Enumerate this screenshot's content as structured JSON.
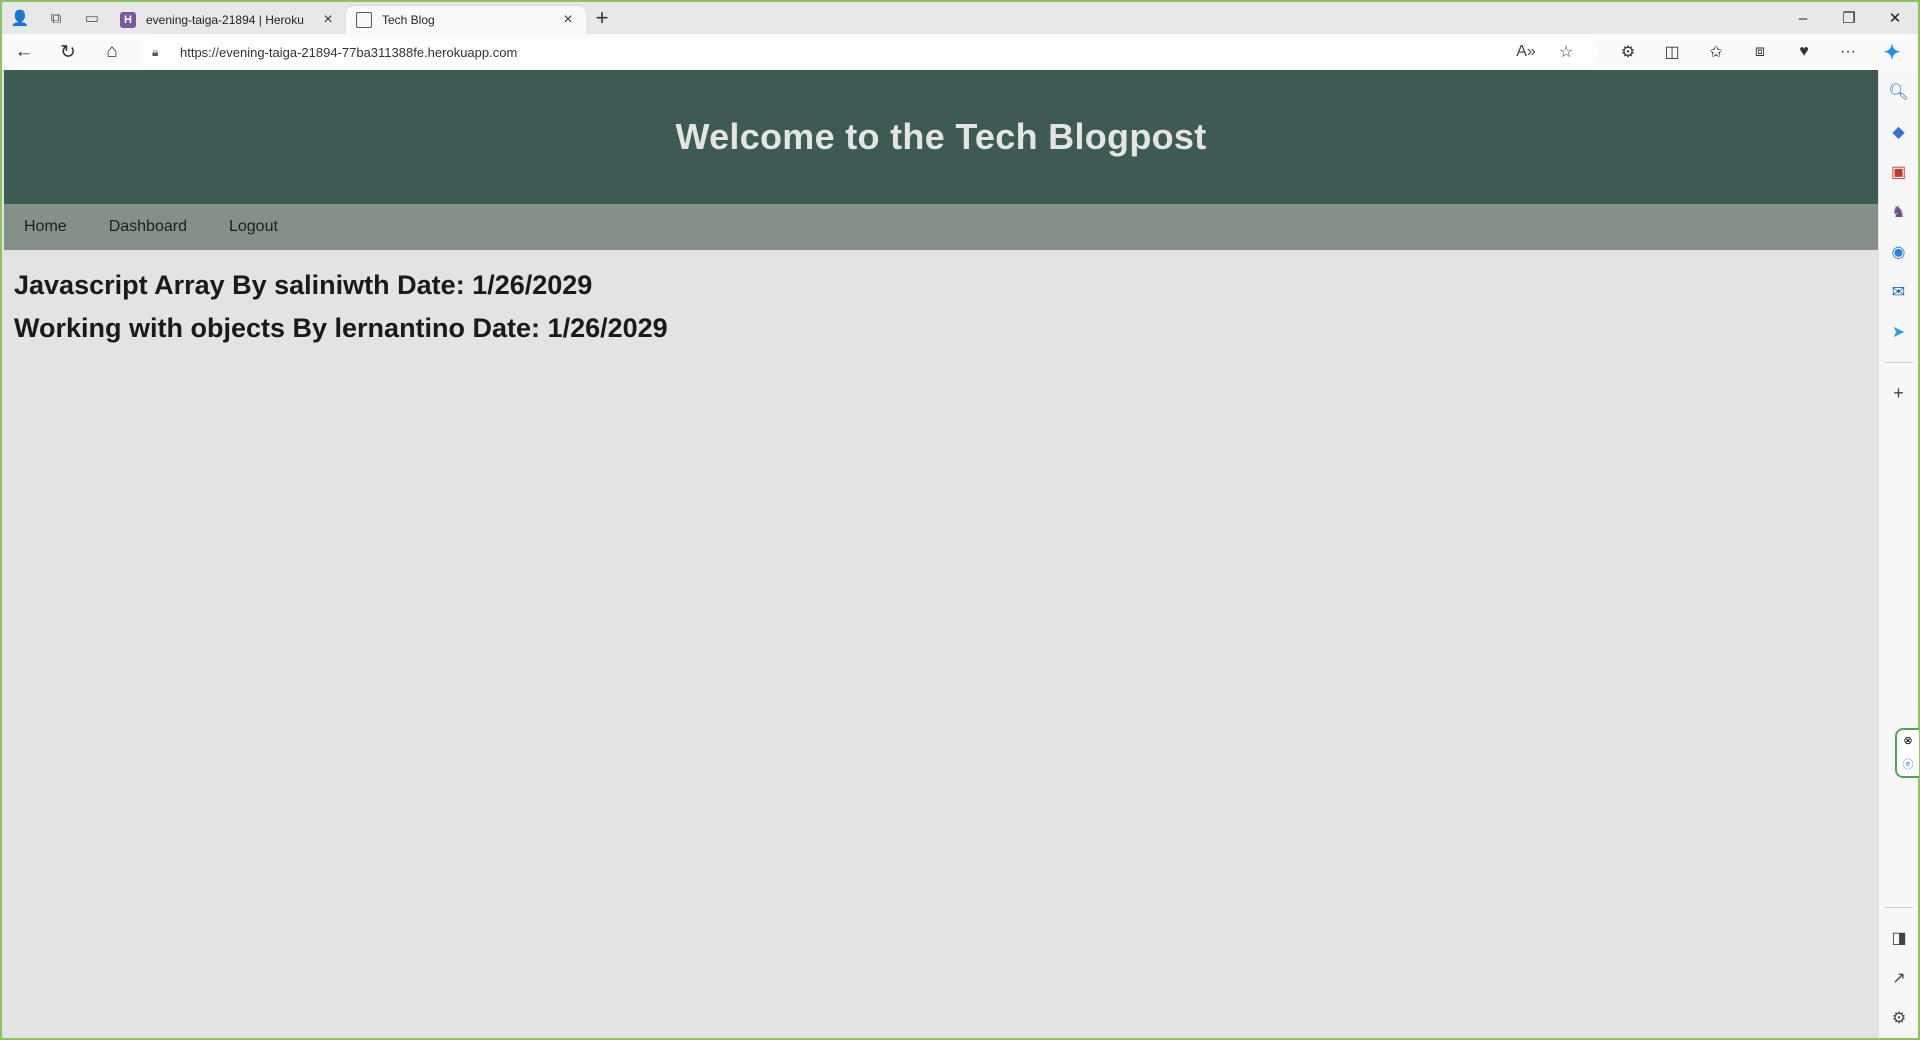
{
  "browser": {
    "tabs": [
      {
        "title": "evening-taiga-21894 | Heroku",
        "favicon": "heroku-icon",
        "active": false
      },
      {
        "title": "Tech Blog",
        "favicon": "page-icon",
        "active": true
      }
    ],
    "address": {
      "url": "https://evening-taiga-21894-77ba311388fe.herokuapp.com"
    }
  },
  "site": {
    "header_title": "Welcome to the Tech Blogpost",
    "nav": [
      {
        "label": "Home"
      },
      {
        "label": "Dashboard"
      },
      {
        "label": "Logout"
      }
    ],
    "posts": [
      {
        "text": "Javascript Array By saliniwth Date: 1/26/2029"
      },
      {
        "text": "Working with objects By lernantino Date: 1/26/2029"
      }
    ]
  },
  "colors": {
    "header_bg": "#3d5a55",
    "nav_bg": "#859089",
    "page_bg": "#e3e3e3",
    "window_border": "#8fc165"
  }
}
